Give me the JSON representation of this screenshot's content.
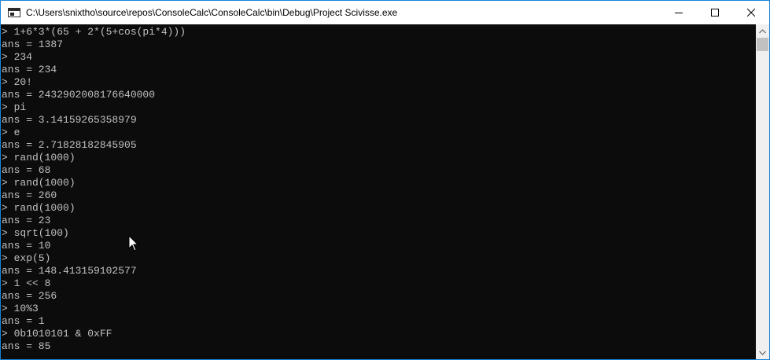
{
  "window": {
    "title": "C:\\Users\\snixtho\\source\\repos\\ConsoleCalc\\ConsoleCalc\\bin\\Debug\\Project Scivisse.exe",
    "accent_border": "#1883d7"
  },
  "controls": {
    "minimize_icon": "minimize-icon",
    "maximize_icon": "maximize-icon",
    "close_icon": "close-icon"
  },
  "console": {
    "foreground": "#c0c0c0",
    "background": "#0c0c0c",
    "lines": [
      "> 1+6*3*(65 + 2*(5+cos(pi*4)))",
      "ans = 1387",
      "> 234",
      "ans = 234",
      "> 20!",
      "ans = 2432902008176640000",
      "> pi",
      "ans = 3.14159265358979",
      "> e",
      "ans = 2.71828182845905",
      "> rand(1000)",
      "ans = 68",
      "> rand(1000)",
      "ans = 260",
      "> rand(1000)",
      "ans = 23",
      "> sqrt(100)",
      "ans = 10",
      "> exp(5)",
      "ans = 148.413159102577",
      "> 1 << 8",
      "ans = 256",
      "> 10%3",
      "ans = 1",
      "> 0b1010101 & 0xFF",
      "ans = 85"
    ]
  }
}
